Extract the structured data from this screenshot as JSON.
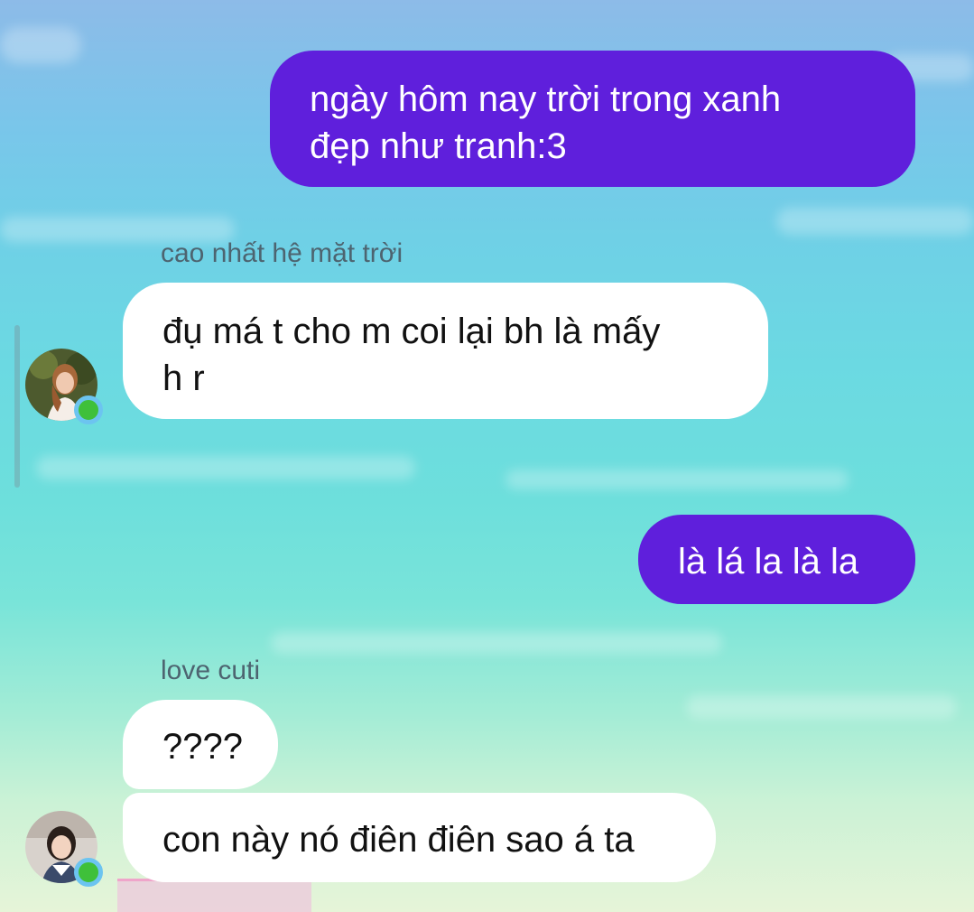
{
  "messages": [
    {
      "direction": "outgoing",
      "lines": [
        "ngày hôm nay trời trong xanh",
        "đẹp như tranh:3"
      ]
    },
    {
      "direction": "incoming",
      "sender": "cao nhất hệ mặt trời",
      "lines": [
        "đụ má t cho m coi lại bh là mấy",
        "h r"
      ]
    },
    {
      "direction": "outgoing",
      "lines": [
        "là lá la là la"
      ]
    },
    {
      "direction": "incoming",
      "sender": "love cuti",
      "lines": [
        "????"
      ]
    },
    {
      "direction": "incoming",
      "lines": [
        "con này nó điên điên sao á ta"
      ]
    }
  ],
  "colors": {
    "outgoing_bubble": "#5f1fdc",
    "incoming_bubble": "#ffffff",
    "online_dot": "#3fc03a",
    "online_ring": "#6cc4f0",
    "sender_name": "#4d6470"
  },
  "icons": {
    "avatar_1": "profile-photo",
    "avatar_2": "profile-photo",
    "presence": "online-dot-icon"
  }
}
